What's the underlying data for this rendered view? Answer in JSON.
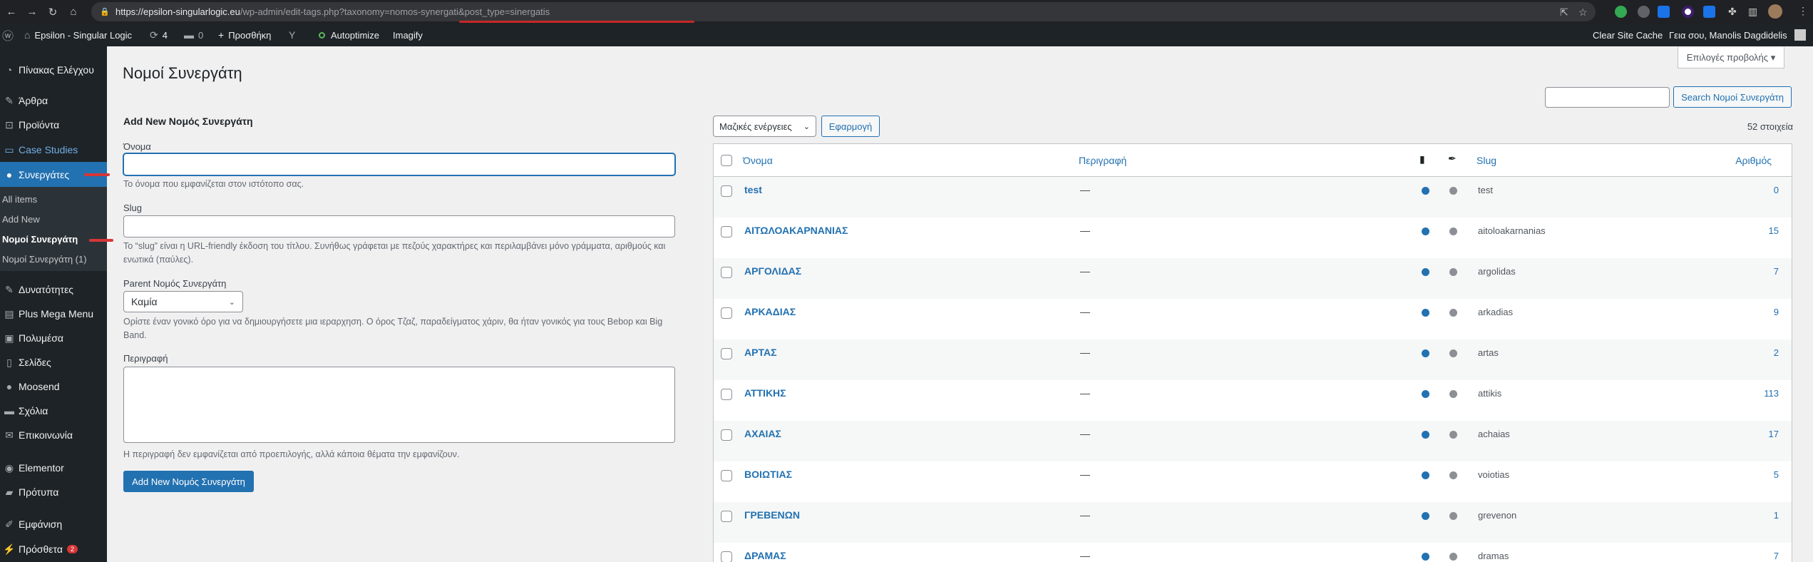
{
  "browser": {
    "url_host": "https://epsilon-singularlogic.eu",
    "url_path": "/wp-admin/edit-tags.php?taxonomy=nomos-synergati&post_type=sinergatis"
  },
  "adminbar": {
    "site_name": "Epsilon - Singular Logic",
    "updates_count": "4",
    "comments_count": "0",
    "new_label": "Προσθήκη",
    "autoptimize_label": "Autoptimize",
    "imagify_label": "Imagify",
    "clear_cache_label": "Clear Site Cache",
    "greeting": "Γεια σου, Manolis Dagdidelis"
  },
  "sidebar": {
    "items": [
      {
        "label": "Πίνακας Ελέγχου",
        "icon": "dashboard-icon"
      },
      {
        "label": "Άρθρα",
        "icon": "pin-icon"
      },
      {
        "label": "Προϊόντα",
        "icon": "cart-icon"
      },
      {
        "label": "Case Studies",
        "icon": "page-icon"
      },
      {
        "label": "Συνεργάτες",
        "icon": "users-icon"
      },
      {
        "label": "Δυνατότητες",
        "icon": "pin-icon"
      },
      {
        "label": "Plus Mega Menu",
        "icon": "grid-icon"
      },
      {
        "label": "Πολυμέσα",
        "icon": "media-icon"
      },
      {
        "label": "Σελίδες",
        "icon": "page-icon"
      },
      {
        "label": "Moosend",
        "icon": "circle-icon"
      },
      {
        "label": "Σχόλια",
        "icon": "comment-icon"
      },
      {
        "label": "Επικοινωνία",
        "icon": "mail-icon"
      },
      {
        "label": "Elementor",
        "icon": "elementor-icon"
      },
      {
        "label": "Πρότυπα",
        "icon": "folder-icon"
      },
      {
        "label": "Εμφάνιση",
        "icon": "brush-icon"
      },
      {
        "label": "Πρόσθετα",
        "icon": "plugin-icon",
        "badge": "2"
      }
    ],
    "submenu": [
      "All items",
      "Add New",
      "Νομοί Συνεργάτη",
      "Νομοί Συνεργάτη (1)"
    ]
  },
  "main": {
    "screen_options": "Επιλογές προβολής",
    "page_title": "Νομοί Συνεργάτη",
    "search_button": "Search Νομοί Συνεργάτη",
    "form": {
      "title": "Add New Νομός Συνεργάτη",
      "name_label": "Όνομα",
      "name_desc": "Το όνομα που εμφανίζεται στον ιστότοπο σας.",
      "slug_label": "Slug",
      "slug_desc": "Το “slug” είναι η URL-friendly έκδοση του τίτλου. Συνήθως γράφεται με πεζούς χαρακτήρες και περιλαμβάνει μόνο γράμματα, αριθμούς και ενωτικά (παύλες).",
      "parent_label": "Parent Νομός Συνεργάτη",
      "parent_value": "Καμία",
      "parent_desc": "Ορίστε έναν γονικό όρο για να δημιουργήσετε μια ιεραρχηση. Ο όρος Τζαζ, παραδείγματος χάριν, θα ήταν γονικός για τους Bebop και Big Band.",
      "desc_label": "Περιγραφή",
      "desc_desc": "Η περιγραφή δεν εμφανίζεται από προεπιλογής, αλλά κάποια θέματα την εμφανίζουν.",
      "submit": "Add New Νομός Συνεργάτη"
    },
    "bulk_actions": "Μαζικές ενέργειες",
    "apply": "Εφαρμογή",
    "items_count": "52 στοιχεία",
    "columns": {
      "name": "Όνομα",
      "description": "Περιγραφή",
      "slug": "Slug",
      "count": "Αριθμός"
    },
    "rows": [
      {
        "name": "test",
        "desc": "—",
        "slug": "test",
        "count": "0"
      },
      {
        "name": "ΑΙΤΩΛΟΑΚΑΡΝΑΝΙΑΣ",
        "desc": "—",
        "slug": "aitoloakarnanias",
        "count": "15"
      },
      {
        "name": "ΑΡΓΟΛΙΔΑΣ",
        "desc": "—",
        "slug": "argolidas",
        "count": "7"
      },
      {
        "name": "ΑΡΚΑΔΙΑΣ",
        "desc": "—",
        "slug": "arkadias",
        "count": "9"
      },
      {
        "name": "ΑΡΤΑΣ",
        "desc": "—",
        "slug": "artas",
        "count": "2"
      },
      {
        "name": "ΑΤΤΙΚΗΣ",
        "desc": "—",
        "slug": "attikis",
        "count": "113"
      },
      {
        "name": "ΑΧΑΙΑΣ",
        "desc": "—",
        "slug": "achaias",
        "count": "17"
      },
      {
        "name": "ΒΟΙΩΤΙΑΣ",
        "desc": "—",
        "slug": "voiotias",
        "count": "5"
      },
      {
        "name": "ΓΡΕΒΕΝΩΝ",
        "desc": "—",
        "slug": "grevenon",
        "count": "1"
      },
      {
        "name": "ΔΡΑΜΑΣ",
        "desc": "—",
        "slug": "dramas",
        "count": "7"
      }
    ]
  }
}
